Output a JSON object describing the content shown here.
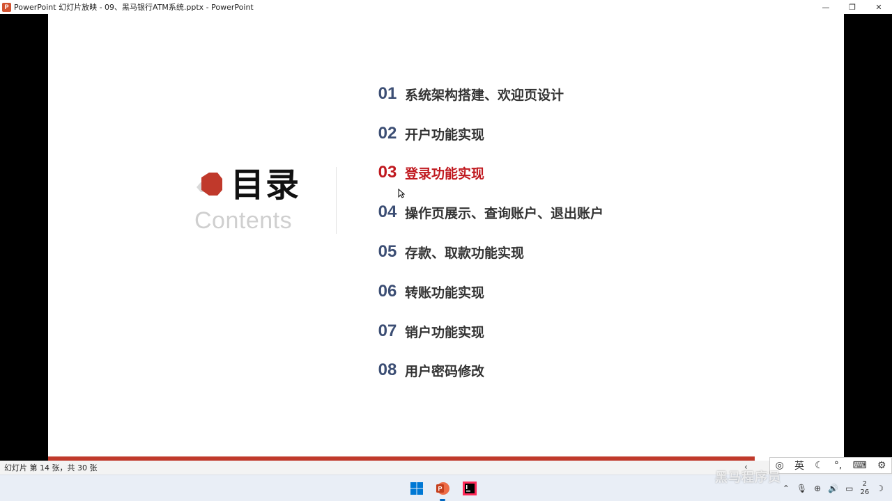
{
  "window": {
    "title": "PowerPoint 幻灯片放映  -  09、黑马银行ATM系统.pptx - PowerPoint",
    "app_logo_letter": "P",
    "controls": {
      "minimize": "—",
      "restore": "❐",
      "close": "✕"
    }
  },
  "slide": {
    "heading": "目录",
    "subheading": "Contents",
    "accent_color": "#c0191f",
    "number_color": "#3c4e74",
    "items": [
      {
        "num": "01",
        "label": "系统架构搭建、欢迎页设计",
        "active": false
      },
      {
        "num": "02",
        "label": "开户功能实现",
        "active": false
      },
      {
        "num": "03",
        "label": "登录功能实现",
        "active": true
      },
      {
        "num": "04",
        "label": "操作页展示、查询账户、退出账户",
        "active": false
      },
      {
        "num": "05",
        "label": "存款、取款功能实现",
        "active": false
      },
      {
        "num": "06",
        "label": "转账功能实现",
        "active": false
      },
      {
        "num": "07",
        "label": "销户功能实现",
        "active": false
      },
      {
        "num": "08",
        "label": "用户密码修改",
        "active": false
      }
    ]
  },
  "statusbar": {
    "slide_counter": "幻灯片 第 14 张，共 30 张"
  },
  "ime": {
    "mode": "英",
    "moon": "☾",
    "punct": "°,",
    "keyboard": "⌨",
    "settings": "⚙"
  },
  "taskbar": {
    "apps": [
      "windows-start",
      "powerpoint",
      "intellij"
    ],
    "tray": {
      "time_line1": "2",
      "time_line2": "26"
    }
  },
  "watermark": "黑马程序员"
}
